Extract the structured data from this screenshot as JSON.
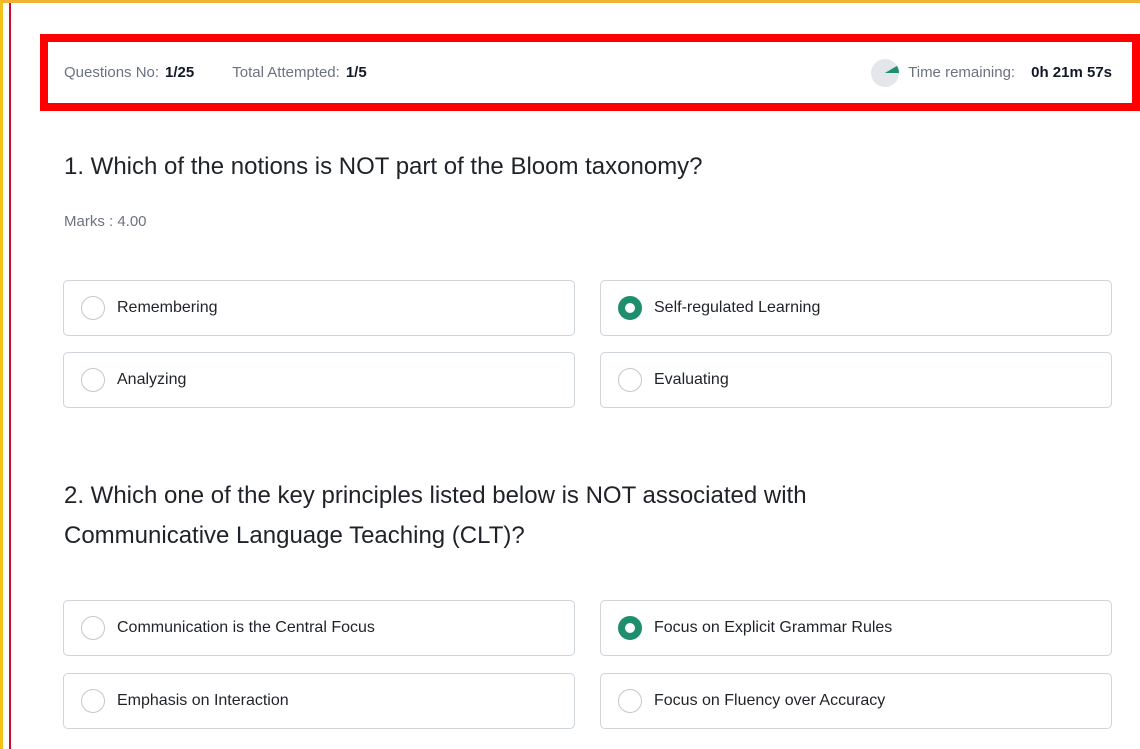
{
  "header": {
    "question_no_label": "Questions No:",
    "question_no_value": "1/25",
    "attempted_label": "Total Attempted:",
    "attempted_value": "1/5",
    "time_label": "Time remaining:",
    "time_value": "0h 21m 57s",
    "timer_icon": "timer-pie-icon",
    "accent_color": "#1e8e6e",
    "highlight_color": "#ff0000"
  },
  "questions": [
    {
      "title": "1. Which of the notions is NOT part of the Bloom taxonomy?",
      "marks": "Marks : 4.00",
      "options": [
        {
          "label": "Remembering",
          "selected": false
        },
        {
          "label": "Self-regulated Learning",
          "selected": true
        },
        {
          "label": "Analyzing",
          "selected": false
        },
        {
          "label": "Evaluating",
          "selected": false
        }
      ]
    },
    {
      "title_line1": "2. Which one of the key principles listed below is NOT associated with",
      "title_line2": "Communicative Language Teaching (CLT)?",
      "options": [
        {
          "label": "Communication is the Central Focus",
          "selected": false
        },
        {
          "label": "Focus on Explicit Grammar Rules",
          "selected": true
        },
        {
          "label": "Emphasis on Interaction",
          "selected": false
        },
        {
          "label": "Focus on Fluency over Accuracy",
          "selected": false
        }
      ]
    }
  ]
}
